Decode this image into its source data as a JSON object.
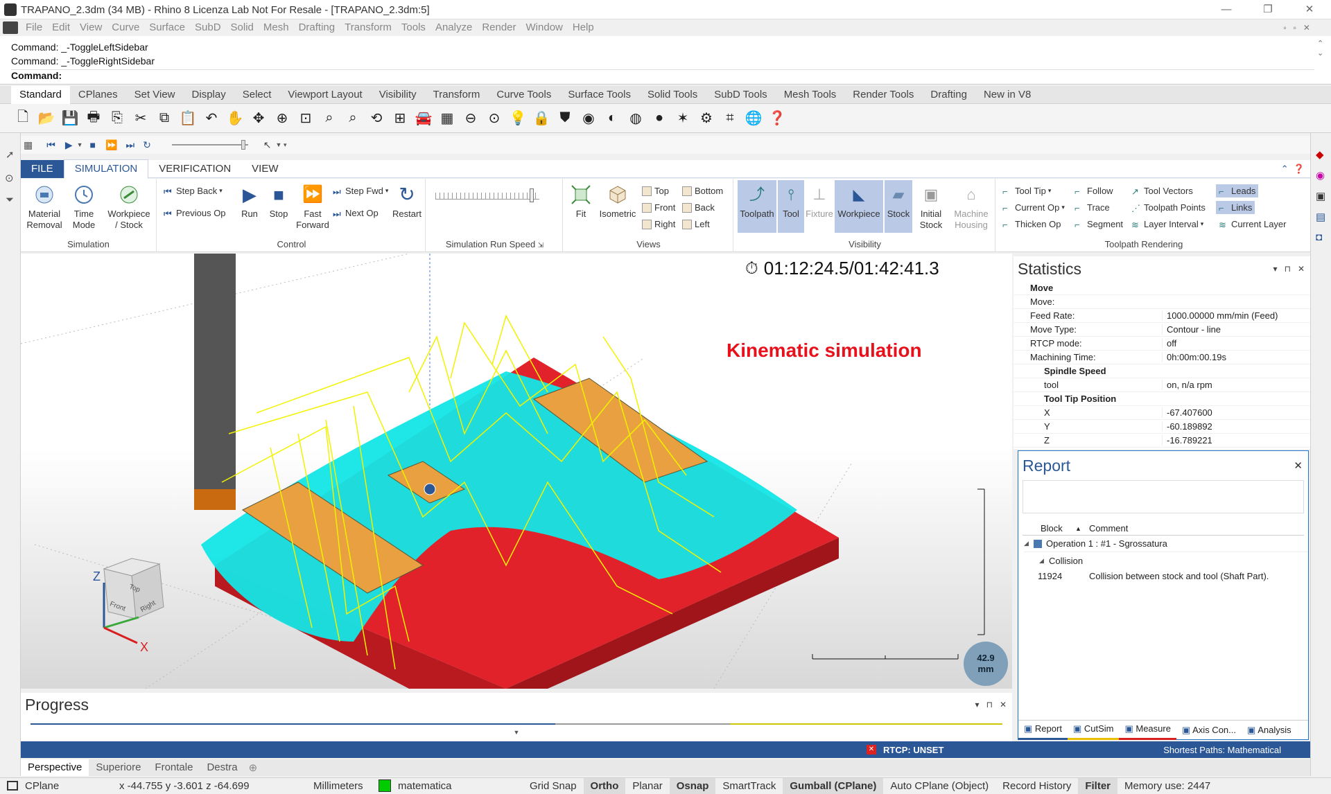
{
  "window": {
    "title": "TRAPANO_2.3dm (34 MB) - Rhino 8 Licenza Lab Not For Resale - [TRAPANO_2.3dm:5]"
  },
  "menu": [
    "File",
    "Edit",
    "View",
    "Curve",
    "Surface",
    "SubD",
    "Solid",
    "Mesh",
    "Drafting",
    "Transform",
    "Tools",
    "Analyze",
    "Render",
    "Window",
    "Help"
  ],
  "command": {
    "history": [
      "Command: _-ToggleLeftSidebar",
      "Command: _-ToggleRightSidebar"
    ],
    "prompt": "Command:"
  },
  "toolbar_tabs": [
    "Standard",
    "CPlanes",
    "Set View",
    "Display",
    "Select",
    "Viewport Layout",
    "Visibility",
    "Transform",
    "Curve Tools",
    "Surface Tools",
    "Solid Tools",
    "SubD Tools",
    "Mesh Tools",
    "Render Tools",
    "Drafting",
    "New in V8"
  ],
  "ribbon_tabs": [
    "FILE",
    "SIMULATION",
    "VERIFICATION",
    "VIEW"
  ],
  "ribbon": {
    "simulation": {
      "label": "Simulation",
      "material_removal": "Material Removal",
      "time_mode": "Time Mode",
      "workpiece_stock": "Workpiece / Stock"
    },
    "control": {
      "label": "Control",
      "step_back": "Step Back",
      "previous_op": "Previous Op",
      "run": "Run",
      "stop": "Stop",
      "fast_forward": "Fast Forward",
      "step_fwd": "Step Fwd",
      "next_op": "Next Op",
      "restart": "Restart"
    },
    "speed": {
      "label": "Simulation Run Speed"
    },
    "views": {
      "label": "Views",
      "fit": "Fit",
      "isometric": "Isometric",
      "top": "Top",
      "bottom": "Bottom",
      "front": "Front",
      "back": "Back",
      "right": "Right",
      "left": "Left"
    },
    "visibility": {
      "label": "Visibility",
      "toolpath": "Toolpath",
      "tool": "Tool",
      "fixture": "Fixture",
      "workpiece": "Workpiece",
      "stock": "Stock",
      "initial_stock": "Initial Stock",
      "machine_housing": "Machine Housing"
    },
    "rendering": {
      "label": "Toolpath Rendering",
      "tool_tip": "Tool Tip",
      "current_op": "Current Op",
      "thicken_op": "Thicken Op",
      "follow": "Follow",
      "trace": "Trace",
      "segment": "Segment",
      "tool_vectors": "Tool Vectors",
      "toolpath_points": "Toolpath Points",
      "layer_interval": "Layer Interval",
      "leads": "Leads",
      "links": "Links",
      "current_layer": "Current Layer"
    }
  },
  "viewport": {
    "timer": "01:12:24.5/01:42:41.3",
    "annotation": "Kinematic simulation",
    "scale": "42.9",
    "scale_unit": "mm",
    "axes": {
      "z": "Z",
      "x": "X"
    },
    "cube": {
      "top": "Top",
      "front": "Front",
      "right": "Right"
    }
  },
  "statistics": {
    "title": "Statistics",
    "rows": [
      {
        "k": "Move",
        "v": "",
        "group": true
      },
      {
        "k": "Move:",
        "v": ""
      },
      {
        "k": "Feed Rate:",
        "v": "1000.00000 mm/min (Feed)"
      },
      {
        "k": "Move Type:",
        "v": "Contour - line"
      },
      {
        "k": "RTCP mode:",
        "v": "off"
      },
      {
        "k": "Machining Time:",
        "v": "0h:00m:00.19s"
      },
      {
        "k": "Spindle Speed",
        "v": "",
        "group": true
      },
      {
        "k": "tool",
        "v": "on, n/a rpm"
      },
      {
        "k": "Tool Tip Position",
        "v": "",
        "group": true
      },
      {
        "k": "X",
        "v": "-67.407600"
      },
      {
        "k": "Y",
        "v": "-60.189892"
      },
      {
        "k": "Z",
        "v": "-16.789221"
      }
    ]
  },
  "report": {
    "title": "Report",
    "col_block": "Block",
    "col_comment": "Comment",
    "operation": "Operation 1 : #1 - Sgrossatura",
    "collision": "Collision",
    "block": "11924",
    "comment": "Collision between stock and tool (Shaft Part).",
    "tabs": [
      "Report",
      "CutSim",
      "Measure",
      "Axis Con...",
      "Analysis"
    ]
  },
  "progress": {
    "title": "Progress"
  },
  "bluebar": {
    "rtcp": "RTCP: UNSET",
    "paths": "Shortest Paths: Mathematical"
  },
  "viewport_tabs": [
    "Perspective",
    "Superiore",
    "Frontale",
    "Destra"
  ],
  "status": {
    "cplane": "CPlane",
    "coords": "x -44.755  y -3.601  z -64.699",
    "units": "Millimeters",
    "layer": "matematica",
    "layer_color": "#00cc00",
    "items": [
      "Grid Snap",
      "Ortho",
      "Planar",
      "Osnap",
      "SmartTrack",
      "Gumball (CPlane)",
      "Auto CPlane (Object)",
      "Record History",
      "Filter"
    ],
    "bold": [
      "Ortho",
      "Osnap",
      "Gumball (CPlane)",
      "Filter"
    ],
    "memory": "Memory use: 2447"
  }
}
